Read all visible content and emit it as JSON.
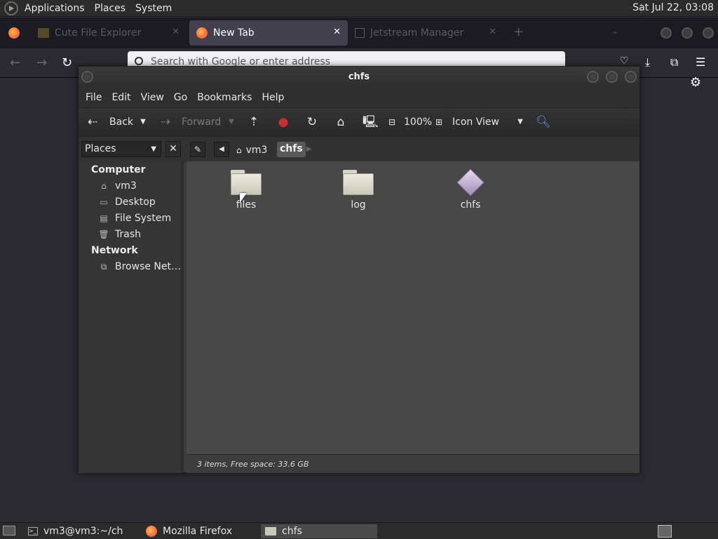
{
  "top_panel": {
    "menus": [
      "Applications",
      "Places",
      "System"
    ],
    "clock": "Sat Jul 22, 03:08"
  },
  "firefox": {
    "tabs": [
      {
        "label": "Cute File Explorer",
        "active": false
      },
      {
        "label": "New Tab",
        "active": true
      },
      {
        "label": "Jetstream Manager",
        "active": false
      }
    ],
    "new_tab_glyph": "+",
    "url_placeholder": "Search with Google or enter address"
  },
  "caja": {
    "title": "chfs",
    "menu": [
      "File",
      "Edit",
      "View",
      "Go",
      "Bookmarks",
      "Help"
    ],
    "toolbar": {
      "back_label": "Back",
      "forward_label": "Forward",
      "zoom": "100%",
      "view_mode": "Icon View"
    },
    "sidebar": {
      "selector": "Places",
      "sections": [
        {
          "header": "Computer",
          "items": [
            "vm3",
            "Desktop",
            "File System",
            "Trash"
          ]
        },
        {
          "header": "Network",
          "items": [
            "Browse Net…"
          ]
        }
      ]
    },
    "breadcrumb": [
      "vm3",
      "chfs"
    ],
    "files": [
      {
        "name": "files",
        "icon": "folder-icon"
      },
      {
        "name": "log",
        "icon": "folder-icon"
      },
      {
        "name": "chfs",
        "icon": "executable-icon"
      }
    ],
    "status": "3 items, Free space: 33.6 GB"
  },
  "taskbar": {
    "tasks": [
      "vm3@vm3:~/ch",
      "Mozilla Firefox",
      "chfs"
    ]
  }
}
